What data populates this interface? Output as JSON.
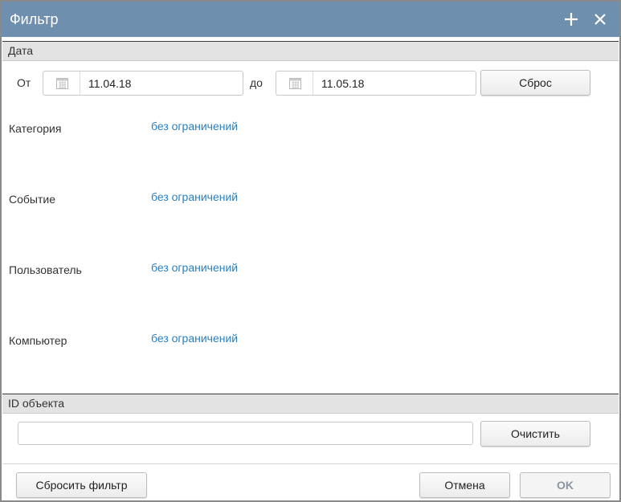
{
  "window": {
    "title": "Фильтр",
    "add_icon": "plus-icon",
    "close_icon": "close-icon"
  },
  "date_section": {
    "header": "Дата",
    "from_label": "От",
    "from_value": "11.04.18",
    "to_label": "до",
    "to_value": "11.05.18",
    "reset_label": "Сброс",
    "calendar_icon": "calendar-icon"
  },
  "filters": [
    {
      "label": "Категория",
      "value": "без ограничений"
    },
    {
      "label": "Событие",
      "value": "без ограничений"
    },
    {
      "label": "Пользователь",
      "value": "без ограничений"
    },
    {
      "label": "Компьютер",
      "value": "без ограничений"
    }
  ],
  "id_section": {
    "header": "ID объекта",
    "value": "",
    "clear_label": "Очистить"
  },
  "footer": {
    "reset_filter_label": "Сбросить фильтр",
    "cancel_label": "Отмена",
    "ok_label": "OK"
  },
  "colors": {
    "titlebar": "#6f8fae",
    "link": "#2a7fc4",
    "ok_disabled_text": "#8a96a3"
  }
}
